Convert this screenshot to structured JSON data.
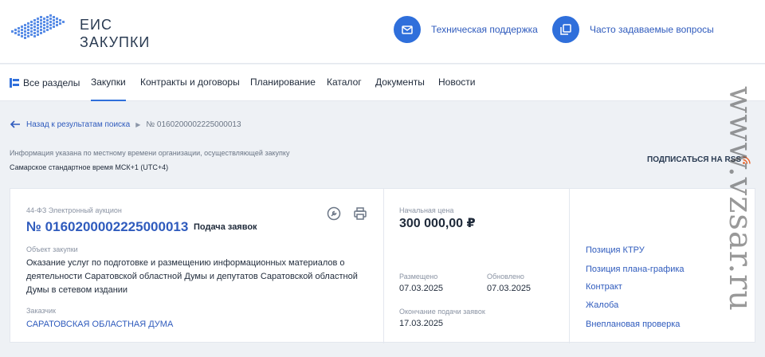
{
  "header": {
    "logo_line1": "ЕИС",
    "logo_line2": "ЗАКУПКИ",
    "support_label": "Техническая поддержка",
    "faq_label": "Часто задаваемые вопросы",
    "accent_color": "#2f6fdb"
  },
  "nav": {
    "items": [
      {
        "label": "Все разделы",
        "icon": "sections-icon"
      },
      {
        "label": "Закупки",
        "active": true
      },
      {
        "label": "Контракты и договоры"
      },
      {
        "label": "Планирование"
      },
      {
        "label": "Каталог"
      },
      {
        "label": "Документы"
      },
      {
        "label": "Новости"
      }
    ]
  },
  "breadcrumb": {
    "back_label": "Назад к результатам поиска",
    "current": "№ 0160200002225000013"
  },
  "timezone": {
    "note": "Информация указана по местному времени организации, осуществляющей закупку",
    "value": "Самарское стандартное время МСК+1 (UTC+4)"
  },
  "rss_label": "ПОДПИСАТЬСЯ НА RSS",
  "card": {
    "law_type": "44-ФЗ Электронный аукцион",
    "reg_number": "№ 0160200002225000013",
    "stage": "Подача заявок",
    "object_label": "Объект закупки",
    "object_text": "Оказание услуг по подготовке и размещению информационных материалов о деятельности Саратовской областной Думы и депутатов Саратовской областной Думы в сетевом издании",
    "customer_label": "Заказчик",
    "customer": "САРАТОВСКАЯ ОБЛАСТНАЯ ДУМА",
    "price_label": "Начальная цена",
    "price": "300 000,00 ₽",
    "placed_label": "Размещено",
    "placed": "07.03.2025",
    "updated_label": "Обновлено",
    "updated": "07.03.2025",
    "deadline_label": "Окончание подачи заявок",
    "deadline": "17.03.2025",
    "links": [
      "Позиция КТРУ",
      "Позиция плана-графика",
      "Контракт",
      "Жалоба",
      "Внеплановая проверка"
    ]
  },
  "watermark": "www.vzsar.ru"
}
